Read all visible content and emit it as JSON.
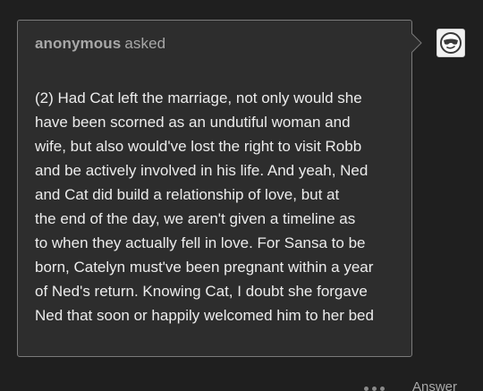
{
  "ask": {
    "asker_name": "anonymous",
    "asked_label": "asked",
    "question_lines": [
      "(2) Had Cat left the marriage, not only would she",
      "have been scorned as an undutiful woman and",
      "wife, but also would've lost the right to visit Robb",
      "and be actively involved in his life. And yeah, Ned",
      "and Cat did build a relationship of love, but at",
      "the end of the day, we aren't given a timeline as",
      "to when they actually fell in love. For Sansa to be",
      "born, Catelyn must've been pregnant within a year",
      "of Ned's return. Knowing Cat, I doubt she forgave",
      "Ned that soon or happily welcomed him to her bed"
    ]
  },
  "avatar": {
    "icon": "anonymous-sunglasses-face-icon"
  },
  "actions": {
    "more_icon": "more-options-icon",
    "answer_label": "Answer"
  },
  "colors": {
    "background": "#1f1f1f",
    "card_background": "#2d2d2d",
    "card_border": "#7a7a7a",
    "body_text": "#ececec",
    "muted_text": "#a8a8a8"
  }
}
